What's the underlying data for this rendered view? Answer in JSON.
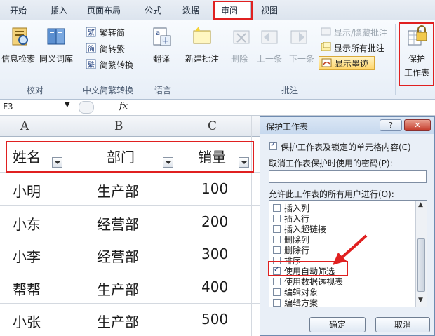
{
  "tabs": [
    "开始",
    "插入",
    "页面布局",
    "公式",
    "数据",
    "审阅",
    "视图"
  ],
  "ribbon": {
    "groups": [
      {
        "label": "校对",
        "buttons": [
          "信息检索",
          "同义词库"
        ]
      },
      {
        "label": "中文简繁转换",
        "buttons": [
          "繁转简",
          "简转繁",
          "简繁转换"
        ]
      },
      {
        "label": "语言",
        "buttons": [
          "翻译"
        ]
      },
      {
        "label": "批注",
        "buttons": [
          "新建批注",
          "删除",
          "上一条",
          "下一条",
          "显示/隐藏批注",
          "显示所有批注",
          "显示墨迹"
        ]
      },
      {
        "label": "",
        "buttons": [
          "保护",
          "工作表"
        ]
      }
    ]
  },
  "formula_bar": {
    "name_box": "F3",
    "fx": "fx",
    "formula": ""
  },
  "sheet": {
    "columns": [
      "A",
      "B",
      "C"
    ],
    "headers": [
      "姓名",
      "部门",
      "销量"
    ],
    "rows": [
      [
        "小明",
        "生产部",
        "100"
      ],
      [
        "小东",
        "经营部",
        "200"
      ],
      [
        "小李",
        "经营部",
        "300"
      ],
      [
        "帮帮",
        "生产部",
        "400"
      ],
      [
        "小张",
        "生产部",
        "500"
      ]
    ]
  },
  "dialog": {
    "title": "保护工作表",
    "help": "?",
    "close": "✕",
    "protect_label": "保护工作表及锁定的单元格内容(C)",
    "password_label": "取消工作表保护时使用的密码(P):",
    "password_value": "",
    "allow_label": "允许此工作表的所有用户进行(O):",
    "options": [
      {
        "label": "插入列",
        "checked": false
      },
      {
        "label": "插入行",
        "checked": false
      },
      {
        "label": "插入超链接",
        "checked": false
      },
      {
        "label": "删除列",
        "checked": false
      },
      {
        "label": "删除行",
        "checked": false
      },
      {
        "label": "排序",
        "checked": false
      },
      {
        "label": "使用自动筛选",
        "checked": true
      },
      {
        "label": "使用数据透视表",
        "checked": false
      },
      {
        "label": "编辑对象",
        "checked": false
      },
      {
        "label": "编辑方案",
        "checked": false
      }
    ],
    "ok": "确定",
    "cancel": "取消"
  },
  "colors": {
    "accent_red": "#e02020",
    "ribbon_bg": "#e7eef7",
    "dialog_bg": "#e9eff7"
  }
}
